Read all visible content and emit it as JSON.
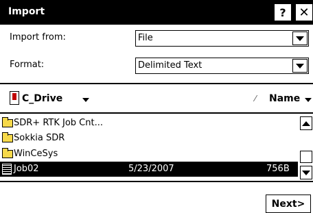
{
  "dialog": {
    "title": "Import",
    "help_label": "?",
    "close_label": "✕"
  },
  "import_from": {
    "label": "Import from:",
    "value": "File"
  },
  "format": {
    "label": "Format:",
    "value": "Delimited Text"
  },
  "browser": {
    "drive_label": "C_Drive",
    "sort_indicator": "⁄",
    "sort_column": "Name"
  },
  "files": [
    {
      "name": "SDR+ RTK Job Cnt...",
      "type": "folder"
    },
    {
      "name": "Sokkia SDR",
      "type": "folder"
    },
    {
      "name": "WinCeSys",
      "type": "folder"
    },
    {
      "name": "Job02",
      "type": "file",
      "date": "5/23/2007",
      "size": "756B",
      "selected": true
    }
  ],
  "footer": {
    "next_label": "Next>"
  },
  "icons": {
    "drive": "drive-icon",
    "folder": "folder-icon",
    "file": "file-icon"
  }
}
